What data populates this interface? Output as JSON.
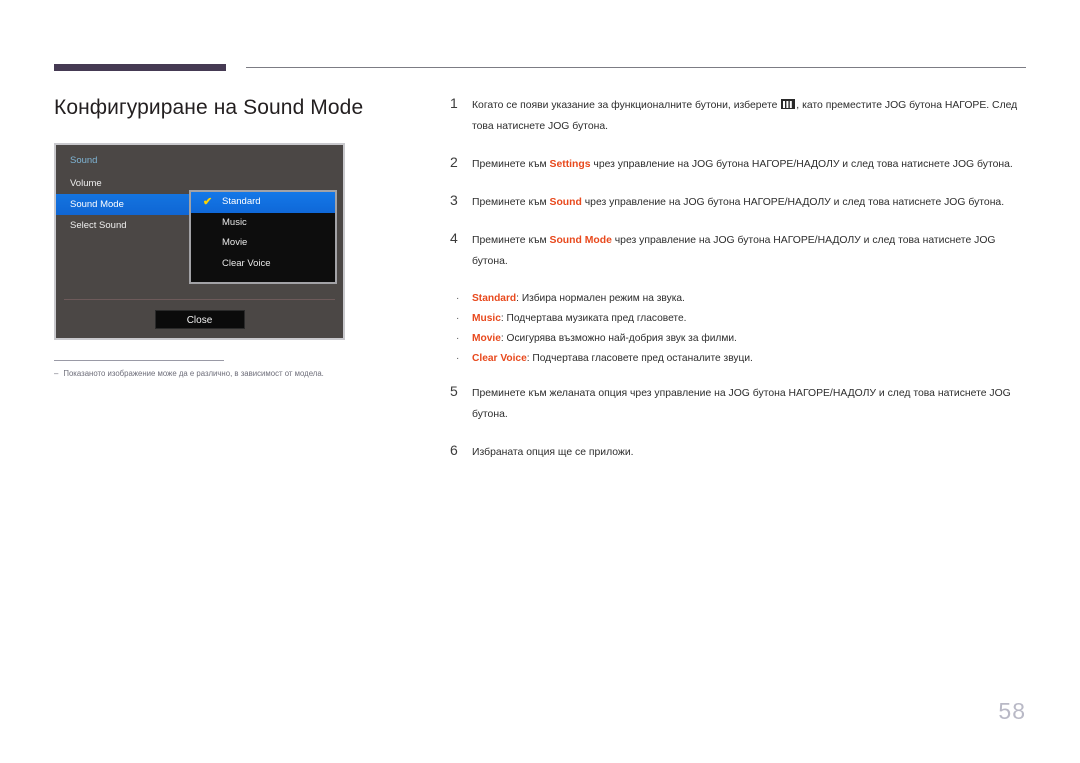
{
  "page": {
    "title": "Конфигуриране на Sound Mode",
    "number": "58"
  },
  "osd": {
    "title": "Sound",
    "menu_items": [
      {
        "label": "Volume",
        "selected": false
      },
      {
        "label": "Sound Mode",
        "selected": true
      },
      {
        "label": "Select Sound",
        "selected": false
      }
    ],
    "submenu_items": [
      {
        "label": "Standard",
        "selected": true,
        "checked": true
      },
      {
        "label": "Music",
        "selected": false,
        "checked": false
      },
      {
        "label": "Movie",
        "selected": false,
        "checked": false
      },
      {
        "label": "Clear Voice",
        "selected": false,
        "checked": false
      }
    ],
    "close_label": "Close",
    "check_glyph": "✔",
    "colors": {
      "panel_bg": "#4b4745",
      "highlight": "#1474e0",
      "title_text": "#7fb4d4",
      "check": "#ffd400"
    }
  },
  "footnote": {
    "dash": "‒",
    "text": "Показаното изображение може да е различно, в зависимост от модела."
  },
  "steps": [
    {
      "num": "1",
      "parts": [
        {
          "type": "text",
          "value": "Когато се появи указание за функционалните бутони, изберете "
        },
        {
          "type": "icon",
          "value": "menu-glyph"
        },
        {
          "type": "text",
          "value": ", като преместите JOG бутона НАГОРЕ. След това натиснете JOG бутона."
        }
      ]
    },
    {
      "num": "2",
      "parts": [
        {
          "type": "text",
          "value": "Преминете към "
        },
        {
          "type": "highlight",
          "value": "Settings"
        },
        {
          "type": "text",
          "value": " чрез управление на JOG бутона НАГОРЕ/НАДОЛУ и след това натиснете JOG бутона."
        }
      ]
    },
    {
      "num": "3",
      "parts": [
        {
          "type": "text",
          "value": "Преминете към "
        },
        {
          "type": "highlight",
          "value": "Sound"
        },
        {
          "type": "text",
          "value": " чрез управление на JOG бутона НАГОРЕ/НАДОЛУ и след това натиснете JOG бутона."
        }
      ]
    },
    {
      "num": "4",
      "parts": [
        {
          "type": "text",
          "value": "Преминете към "
        },
        {
          "type": "highlight",
          "value": "Sound Mode"
        },
        {
          "type": "text",
          "value": " чрез управление на JOG бутона НАГОРЕ/НАДОЛУ и след това натиснете JOG бутона."
        }
      ]
    }
  ],
  "bullets": [
    {
      "marker": "·",
      "term": "Standard",
      "desc": ": Избира нормален режим на звука."
    },
    {
      "marker": "·",
      "term": "Music",
      "desc": ": Подчертава музиката пред гласовете."
    },
    {
      "marker": "·",
      "term": "Movie",
      "desc": ": Осигурява възможно най-добрия звук за филми."
    },
    {
      "marker": "·",
      "term": "Clear Voice",
      "desc": ": Подчертава гласовете пред останалите звуци."
    }
  ],
  "steps_after": [
    {
      "num": "5",
      "parts": [
        {
          "type": "text",
          "value": "Преминете към желаната опция чрез управление на JOG бутона НАГОРЕ/НАДОЛУ и след това натиснете JOG бутона."
        }
      ]
    },
    {
      "num": "6",
      "parts": [
        {
          "type": "text",
          "value": "Избраната опция ще се приложи."
        }
      ]
    }
  ],
  "colors": {
    "accent_orange": "#e8491d",
    "rule_purple": "#453a53",
    "page_number": "#b9b9c6"
  }
}
